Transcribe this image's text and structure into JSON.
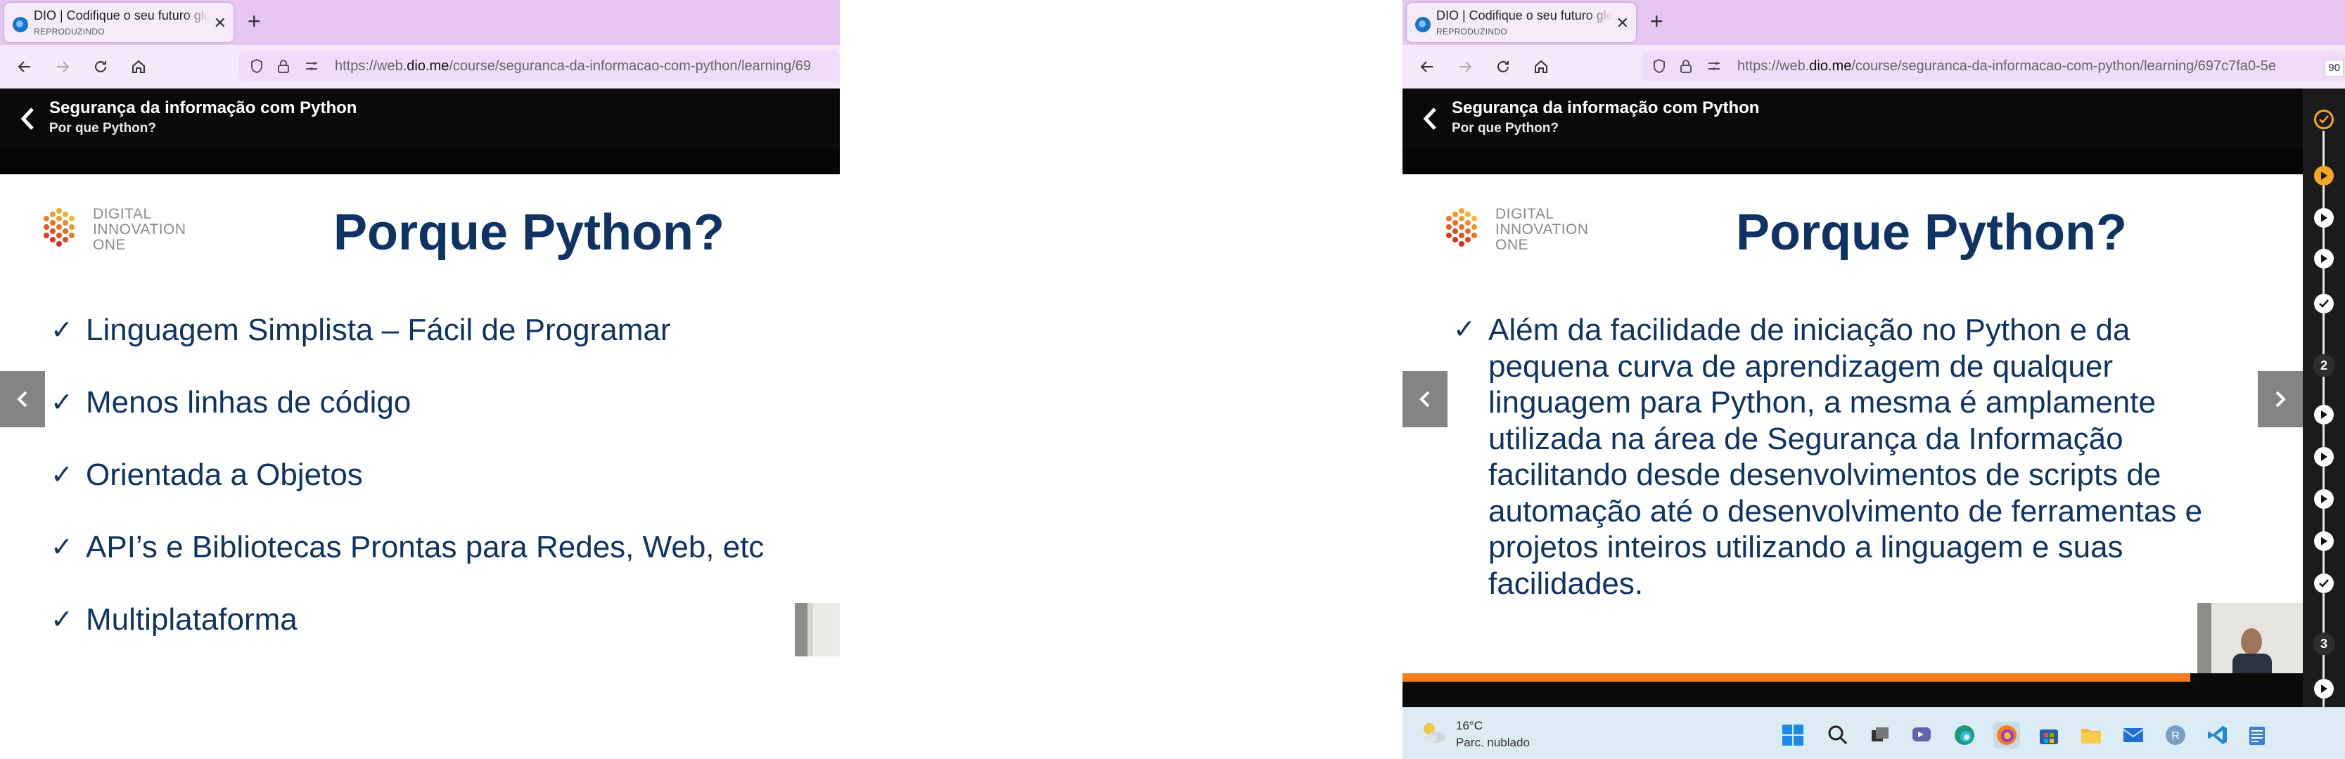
{
  "browser": {
    "tab_title": "DIO | Codifique o seu futuro global",
    "tab_status": "REPRODUZINDO",
    "new_tab": "+",
    "url_left_prefix": "https://web.",
    "url_left_domain": "dio.me",
    "url_left_path": "/course/seguranca-da-informacao-com-python/learning/69",
    "url_right_prefix": "https://web.",
    "url_right_domain": "dio.me",
    "url_right_path": "/course/seguranca-da-informacao-com-python/learning/697c7fa0-5e",
    "zoom": "90"
  },
  "course": {
    "title": "Segurança da informação com Python",
    "lesson": "Por que Python?"
  },
  "logo": {
    "line1": "DIGITAL",
    "line2": "INNOVATION",
    "line3": "ONE"
  },
  "slide_left": {
    "title": "Porque Python?",
    "bullets": [
      "Linguagem Simplista – Fácil de Programar",
      "Menos linhas de código",
      "Orientada a Objetos",
      "API’s e Bibliotecas Prontas para Redes, Web, etc",
      "Multiplataforma"
    ]
  },
  "slide_right": {
    "title": "Porque Python?",
    "paragraph": "Além da facilidade de iniciação no Python e da pequena curva de aprendizagem de qualquer linguagem para Python, a mesma é amplamente utilizada na área de Segurança da Informação facilitando desde desenvolvimentos de scripts de automação até o desenvolvimento de ferramentas e projetos inteiros utilizando a linguagem e suas facilidades."
  },
  "timeline": {
    "section_2": "2",
    "section_3": "3"
  },
  "taskbar": {
    "temperature": "16°C",
    "weather": "Parc. nublado"
  },
  "colors": {
    "tab_strip": "#e6c6f2",
    "slide_text": "#0f3463",
    "accent_orange": "#f57c1f",
    "header_bg": "#0a0a0a"
  }
}
